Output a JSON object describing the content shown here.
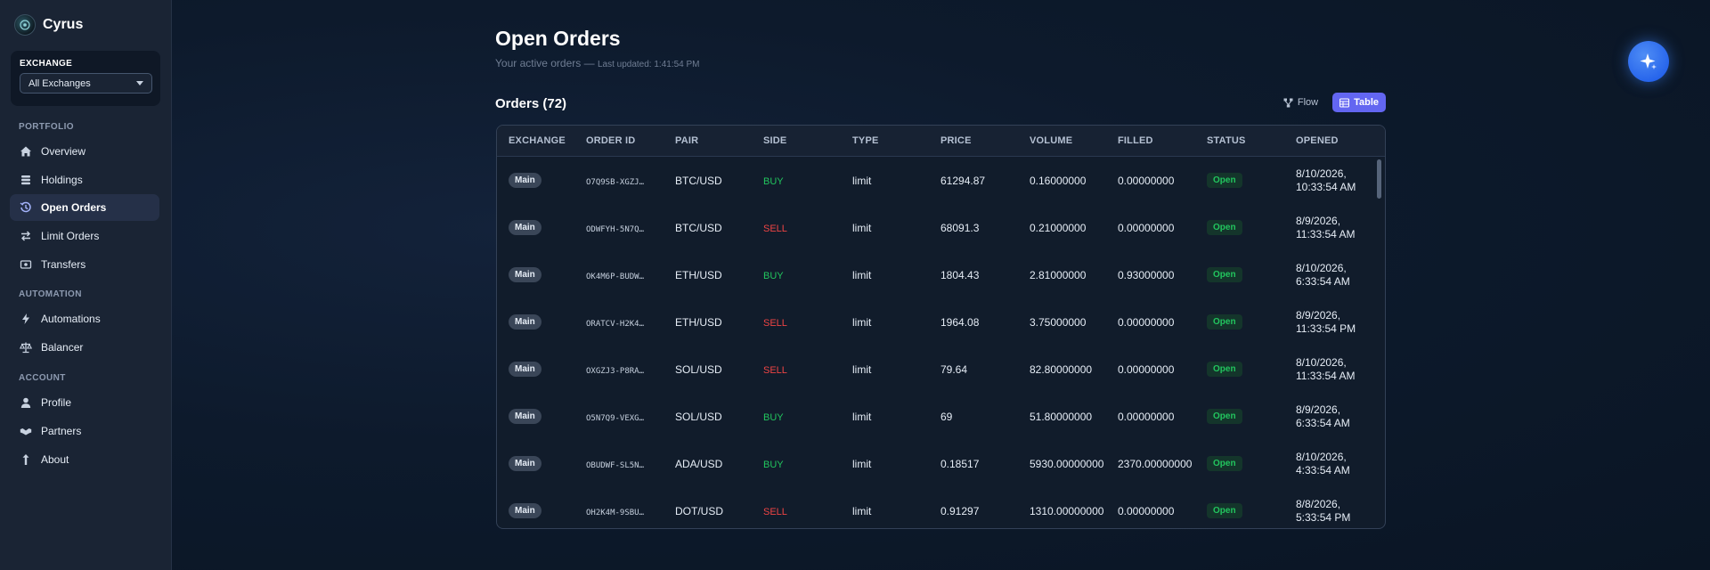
{
  "brand": {
    "name": "Cyrus"
  },
  "exchange": {
    "label": "EXCHANGE",
    "selected": "All Exchanges"
  },
  "sidebar": {
    "sections": [
      {
        "title": "PORTFOLIO"
      },
      {
        "title": "AUTOMATION"
      },
      {
        "title": "ACCOUNT"
      }
    ],
    "items": [
      {
        "label": "Overview",
        "icon": "home-icon"
      },
      {
        "label": "Holdings",
        "icon": "stack-icon"
      },
      {
        "label": "Open Orders",
        "icon": "history-icon",
        "active": true
      },
      {
        "label": "Limit Orders",
        "icon": "swap-icon"
      },
      {
        "label": "Transfers",
        "icon": "transfer-icon"
      },
      {
        "label": "Automations",
        "icon": "bolt-icon"
      },
      {
        "label": "Balancer",
        "icon": "scale-icon"
      },
      {
        "label": "Profile",
        "icon": "user-icon"
      },
      {
        "label": "Partners",
        "icon": "handshake-icon"
      },
      {
        "label": "About",
        "icon": "info-icon"
      }
    ]
  },
  "page": {
    "title": "Open Orders",
    "subtitle": "Your active orders",
    "separator": "—",
    "updated": "Last updated: 1:41:54 PM"
  },
  "orders": {
    "heading": "Orders (72)",
    "view_flow": "Flow",
    "view_table": "Table",
    "columns": [
      "EXCHANGE",
      "ORDER ID",
      "PAIR",
      "SIDE",
      "TYPE",
      "PRICE",
      "VOLUME",
      "FILLED",
      "STATUS",
      "OPENED"
    ],
    "rows": [
      {
        "exchange": "Main",
        "id": "O7Q9SB-XGZJ…",
        "pair": "BTC/USD",
        "side": "BUY",
        "type": "limit",
        "price": "61294.87",
        "volume": "0.16000000",
        "filled": "0.00000000",
        "status": "Open",
        "opened_date": "8/10/2026,",
        "opened_time": "10:33:54 AM"
      },
      {
        "exchange": "Main",
        "id": "ODWFYH-5N7Q…",
        "pair": "BTC/USD",
        "side": "SELL",
        "type": "limit",
        "price": "68091.3",
        "volume": "0.21000000",
        "filled": "0.00000000",
        "status": "Open",
        "opened_date": "8/9/2026,",
        "opened_time": "11:33:54 AM"
      },
      {
        "exchange": "Main",
        "id": "OK4M6P-BUDW…",
        "pair": "ETH/USD",
        "side": "BUY",
        "type": "limit",
        "price": "1804.43",
        "volume": "2.81000000",
        "filled": "0.93000000",
        "status": "Open",
        "opened_date": "8/10/2026,",
        "opened_time": "6:33:54 AM"
      },
      {
        "exchange": "Main",
        "id": "ORATCV-H2K4…",
        "pair": "ETH/USD",
        "side": "SELL",
        "type": "limit",
        "price": "1964.08",
        "volume": "3.75000000",
        "filled": "0.00000000",
        "status": "Open",
        "opened_date": "8/9/2026,",
        "opened_time": "11:33:54 PM"
      },
      {
        "exchange": "Main",
        "id": "OXGZJ3-P8RA…",
        "pair": "SOL/USD",
        "side": "SELL",
        "type": "limit",
        "price": "79.64",
        "volume": "82.80000000",
        "filled": "0.00000000",
        "status": "Open",
        "opened_date": "8/10/2026,",
        "opened_time": "11:33:54 AM"
      },
      {
        "exchange": "Main",
        "id": "O5N7Q9-VEXG…",
        "pair": "SOL/USD",
        "side": "BUY",
        "type": "limit",
        "price": "69",
        "volume": "51.80000000",
        "filled": "0.00000000",
        "status": "Open",
        "opened_date": "8/9/2026,",
        "opened_time": "6:33:54 AM"
      },
      {
        "exchange": "Main",
        "id": "OBUDWF-SL5N…",
        "pair": "ADA/USD",
        "side": "BUY",
        "type": "limit",
        "price": "0.18517",
        "volume": "5930.00000000",
        "filled": "2370.00000000",
        "status": "Open",
        "opened_date": "8/10/2026,",
        "opened_time": "4:33:54 AM"
      },
      {
        "exchange": "Main",
        "id": "OH2K4M-9SBU…",
        "pair": "DOT/USD",
        "side": "SELL",
        "type": "limit",
        "price": "0.91297",
        "volume": "1310.00000000",
        "filled": "0.00000000",
        "status": "Open",
        "opened_date": "8/8/2026,",
        "opened_time": "5:33:54 PM"
      }
    ]
  },
  "colors": {
    "accent": "#6366f1",
    "buy": "#22c55e",
    "sell": "#ef4444",
    "fab": "#3b82f6"
  }
}
